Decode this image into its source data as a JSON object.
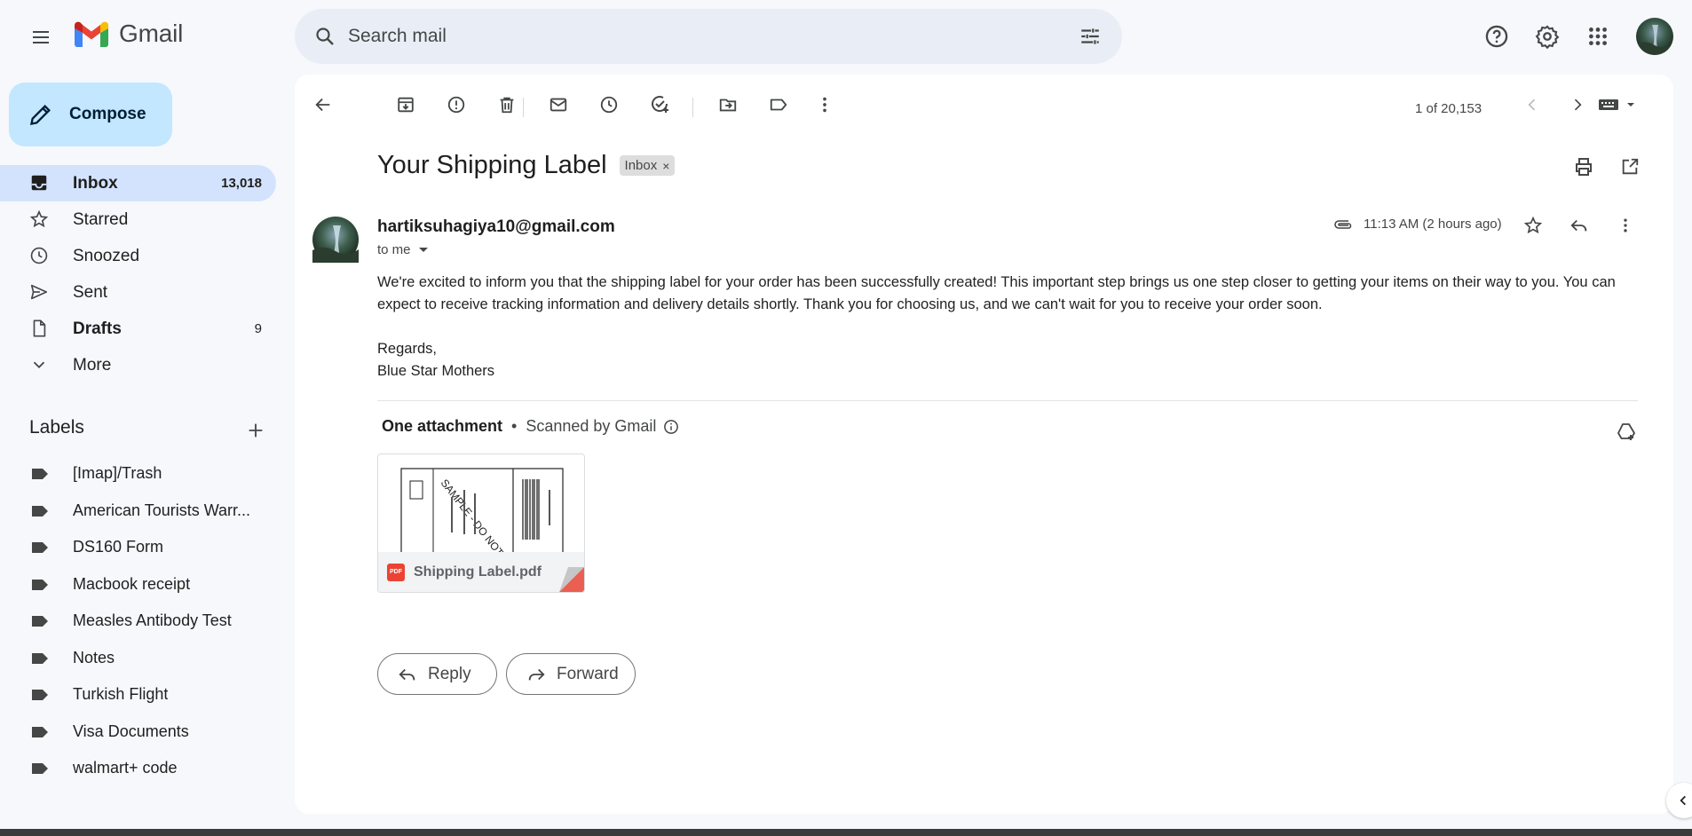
{
  "app": {
    "logo_text": "Gmail",
    "search_placeholder": "Search mail"
  },
  "icons": {
    "menu": "menu-icon",
    "search": "search-icon",
    "tune": "tune-icon",
    "help": "help-icon",
    "settings": "gear-icon",
    "apps": "apps-grid-icon"
  },
  "compose_label": "Compose",
  "nav": [
    {
      "label": "Inbox",
      "count": "13,018",
      "icon": "inbox-icon",
      "active": true,
      "bold": true
    },
    {
      "label": "Starred",
      "count": "",
      "icon": "star-icon",
      "active": false,
      "bold": false
    },
    {
      "label": "Snoozed",
      "count": "",
      "icon": "clock-icon",
      "active": false,
      "bold": false
    },
    {
      "label": "Sent",
      "count": "",
      "icon": "send-icon",
      "active": false,
      "bold": false
    },
    {
      "label": "Drafts",
      "count": "9",
      "icon": "draft-icon",
      "active": false,
      "bold": true
    },
    {
      "label": "More",
      "count": "",
      "icon": "chevron-down-icon",
      "active": false,
      "bold": false
    }
  ],
  "labels_title": "Labels",
  "labels": [
    "[Imap]/Trash",
    "American Tourists Warr...",
    "DS160 Form",
    "Macbook receipt",
    "Measles Antibody Test",
    "Notes",
    "Turkish Flight",
    "Visa Documents",
    "walmart+ code"
  ],
  "toolbar": {
    "pager": "1 of 20,153"
  },
  "email": {
    "subject": "Your Shipping Label",
    "chip": "Inbox",
    "chip_close": "×",
    "sender": "hartiksuhagiya10@gmail.com",
    "to": "to me",
    "time": "11:13 AM (2 hours ago)",
    "body_p1": "We're excited to inform you that the shipping label for your order has been successfully created! This important step brings us one step closer to getting your items on their way to you. You can expect to receive tracking information and delivery details shortly. Thank you for choosing us, and we can't wait for you to receive your order soon.",
    "regards": "Regards,",
    "signature": "Blue Star Mothers"
  },
  "attachments": {
    "heading": "One attachment",
    "dot": "•",
    "scanned": "Scanned by Gmail",
    "file_name": "Shipping Label.pdf",
    "file_badge": "PDF"
  },
  "actions": {
    "reply": "Reply",
    "forward": "Forward"
  },
  "colors": {
    "background": "#f6f8fc",
    "compose": "#c2e7ff",
    "active_nav": "#d3e3fd",
    "search": "#e9eef6",
    "pdf_red": "#ea4335"
  }
}
